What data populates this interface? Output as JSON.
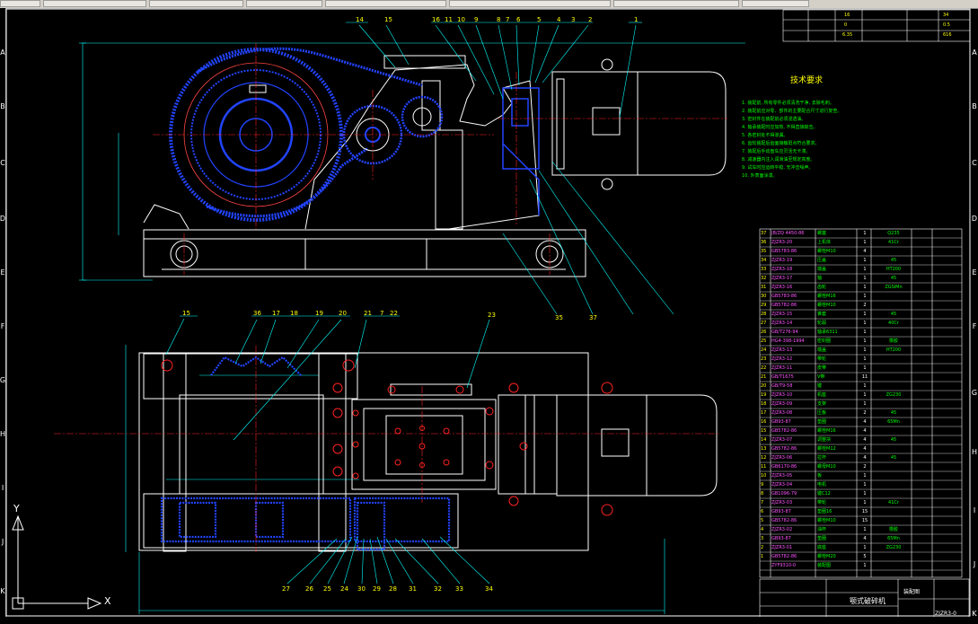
{
  "toolbar": {
    "buttons": [
      "",
      "",
      "",
      "",
      "",
      "",
      "",
      ""
    ]
  },
  "rulers": {
    "left_letters": [
      "A",
      "B",
      "C",
      "D",
      "E",
      "F",
      "G",
      "H",
      "I",
      "J",
      "K"
    ],
    "right_letters": [
      "A",
      "B",
      "C",
      "D",
      "E",
      "F",
      "G",
      "H",
      "I",
      "J",
      "K"
    ]
  },
  "ucs": {
    "x_label": "X",
    "y_label": "Y"
  },
  "technical_requirements": {
    "title": "技术要求",
    "lines": [
      "1. 装配前, 所有零件必须清洗干净, 去除毛刺。",
      "2. 装配前应对零、部件的主要配合尺寸进行复查。",
      "3. 密封件在装配前必须浸透油。",
      "4. 轴承装配时应加热, 不得直接敲击。",
      "5. 各密封处不得渗漏。",
      "6. 齿轮装配后齿面接触斑点符合要求。",
      "7. 装配后手动盘车应灵活无卡滞。",
      "8. 减速器内注入润滑油至规定高度。",
      "9. 试车时应运转平稳, 无冲击噪声。",
      "10. 外表面涂漆。"
    ]
  },
  "top_table": {
    "cells": [
      "16",
      "34",
      "0",
      "0.5",
      "6.35",
      "616"
    ]
  },
  "bom": {
    "rows": [
      {
        "no": "37",
        "code": "JB/ZQ 4450-86",
        "name": "螺塞",
        "qty": "1",
        "mat": "Q235",
        "note": ""
      },
      {
        "no": "36",
        "code": "ZJZR3-20",
        "name": "上机体",
        "qty": "1",
        "mat": "41Cr",
        "note": ""
      },
      {
        "no": "35",
        "code": "GB5783-86",
        "name": "螺栓M10",
        "qty": "4",
        "mat": "",
        "note": ""
      },
      {
        "no": "34",
        "code": "ZJZR3-19",
        "name": "压盖",
        "qty": "1",
        "mat": "45",
        "note": ""
      },
      {
        "no": "33",
        "code": "ZJZR3-18",
        "name": "端盖",
        "qty": "1",
        "mat": "HT200",
        "note": ""
      },
      {
        "no": "32",
        "code": "ZJZR3-17",
        "name": "轴",
        "qty": "1",
        "mat": "45",
        "note": ""
      },
      {
        "no": "31",
        "code": "ZJZR3-16",
        "name": "齿轮",
        "qty": "1",
        "mat": "ZGSiMn",
        "note": ""
      },
      {
        "no": "30",
        "code": "GB5783-86",
        "name": "螺栓M16",
        "qty": "1",
        "mat": "",
        "note": ""
      },
      {
        "no": "29",
        "code": "GB5782-86",
        "name": "螺栓M10",
        "qty": "2",
        "mat": "",
        "note": ""
      },
      {
        "no": "28",
        "code": "ZJZR3-15",
        "name": "锥套",
        "qty": "1",
        "mat": "45",
        "note": ""
      },
      {
        "no": "27",
        "code": "ZJZR3-14",
        "name": "轮毂",
        "qty": "1",
        "mat": "40Cr",
        "note": ""
      },
      {
        "no": "26",
        "code": "GB/T276-94",
        "name": "轴承6311",
        "qty": "1",
        "mat": "",
        "note": ""
      },
      {
        "no": "25",
        "code": "HG4-398-1994",
        "name": "密封圈",
        "qty": "1",
        "mat": "橡胶",
        "note": ""
      },
      {
        "no": "24",
        "code": "ZJZR3-13",
        "name": "端盖",
        "qty": "1",
        "mat": "HT200",
        "note": ""
      },
      {
        "no": "23",
        "code": "ZJZR3-12",
        "name": "带轮",
        "qty": "1",
        "mat": "",
        "note": ""
      },
      {
        "no": "22",
        "code": "ZJZR3-11",
        "name": "皮带",
        "qty": "1",
        "mat": "",
        "note": ""
      },
      {
        "no": "21",
        "code": "GB/T1675",
        "name": "V带",
        "qty": "11",
        "mat": "",
        "note": ""
      },
      {
        "no": "20",
        "code": "GB/T9-58",
        "name": "键",
        "qty": "1",
        "mat": "",
        "note": ""
      },
      {
        "no": "19",
        "code": "ZJZR3-10",
        "name": "机座",
        "qty": "1",
        "mat": "ZG230",
        "note": ""
      },
      {
        "no": "18",
        "code": "ZJZR3-09",
        "name": "支架",
        "qty": "1",
        "mat": "",
        "note": ""
      },
      {
        "no": "17",
        "code": "ZJZR3-08",
        "name": "压板",
        "qty": "2",
        "mat": "45",
        "note": ""
      },
      {
        "no": "16",
        "code": "GB93-87",
        "name": "垫圈",
        "qty": "4",
        "mat": "65Mn",
        "note": ""
      },
      {
        "no": "15",
        "code": "GB5782-86",
        "name": "螺栓M16",
        "qty": "4",
        "mat": "",
        "note": ""
      },
      {
        "no": "14",
        "code": "ZJZR3-07",
        "name": "调整块",
        "qty": "4",
        "mat": "45",
        "note": ""
      },
      {
        "no": "13",
        "code": "GB5782-86",
        "name": "螺栓M12",
        "qty": "4",
        "mat": "",
        "note": ""
      },
      {
        "no": "12",
        "code": "ZJZR3-06",
        "name": "拉杆",
        "qty": "4",
        "mat": "45",
        "note": ""
      },
      {
        "no": "11",
        "code": "GB6170-86",
        "name": "螺母M10",
        "qty": "2",
        "mat": "",
        "note": ""
      },
      {
        "no": "10",
        "code": "ZJZR3-05",
        "name": "板",
        "qty": "1",
        "mat": "",
        "note": ""
      },
      {
        "no": "9",
        "code": "ZJZR3-04",
        "name": "电机",
        "qty": "1",
        "mat": "",
        "note": ""
      },
      {
        "no": "8",
        "code": "GB1096-79",
        "name": "键C12",
        "qty": "1",
        "mat": "",
        "note": ""
      },
      {
        "no": "7",
        "code": "ZJZR3-03",
        "name": "带轮",
        "qty": "1",
        "mat": "41Cr",
        "note": ""
      },
      {
        "no": "6",
        "code": "GB93-87",
        "name": "垫圈16",
        "qty": "15",
        "mat": "",
        "note": ""
      },
      {
        "no": "5",
        "code": "GB5782-86",
        "name": "螺栓M10",
        "qty": "15",
        "mat": "",
        "note": ""
      },
      {
        "no": "4",
        "code": "ZJZR3-02",
        "name": "油杯",
        "qty": "1",
        "mat": "橡胶",
        "note": ""
      },
      {
        "no": "3",
        "code": "GB93-87",
        "name": "垫圈",
        "qty": "4",
        "mat": "65Mn",
        "note": ""
      },
      {
        "no": "2",
        "code": "ZJZR3-01",
        "name": "底座",
        "qty": "1",
        "mat": "ZG230",
        "note": ""
      },
      {
        "no": "1",
        "code": "GB5782-86",
        "name": "螺栓M20",
        "qty": "5",
        "mat": "",
        "note": ""
      },
      {
        "no": "",
        "code": "ZYF9310-0",
        "name": "装配图",
        "qty": "1",
        "mat": "",
        "note": ""
      }
    ]
  },
  "title_block": {
    "main": "颚式破碎机",
    "sub": "装配图",
    "part_no": "ZJZR3-0"
  },
  "part_numbers_top": [
    "14",
    "15",
    "16",
    "11",
    "10",
    "9",
    "8",
    "7",
    "6",
    "5",
    "4",
    "3",
    "2",
    "1"
  ],
  "part_numbers_bottom": [
    "15",
    "36",
    "17",
    "18",
    "19",
    "20",
    "21",
    "7",
    "22",
    "23"
  ],
  "leader_numbers_lower": [
    "27",
    "26",
    "25",
    "24",
    "30",
    "29",
    "28",
    "31",
    "32",
    "33",
    "34",
    "35",
    "37"
  ],
  "colors": {
    "outline": "#ffffff",
    "belt": "#2244ff",
    "center": "#ff2222",
    "dim": "#00ffff",
    "leader": "#00ffff",
    "green": "#00ff00",
    "yellow": "#ffff00"
  }
}
